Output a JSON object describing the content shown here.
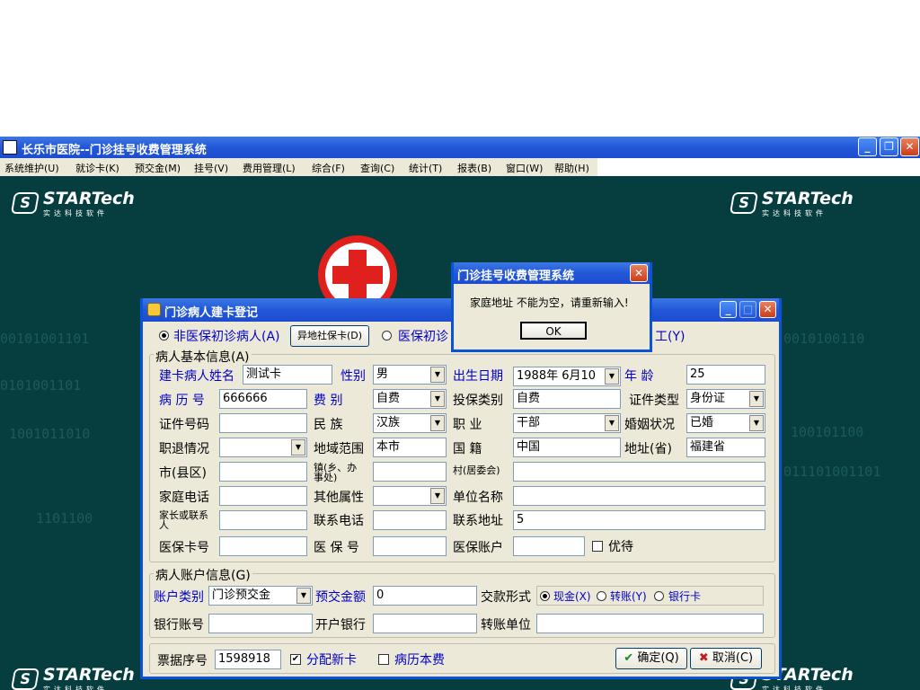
{
  "app": {
    "title": "长乐市医院--门诊挂号收费管理系统",
    "menu": [
      "系统维护(U)",
      "就诊卡(K)",
      "预交金(M)",
      "挂号(V)",
      "费用管理(L)",
      "综合(F)",
      "查询(C)",
      "统计(T)",
      "报表(B)",
      "窗口(W)",
      "帮助(H)"
    ]
  },
  "branding": {
    "name": "STARTech",
    "sub": "实达科技软件"
  },
  "background_binary": [
    "00101001101",
    "0101001101",
    "1001011010",
    "1101100",
    "0010100110",
    "100101100",
    "011101001101"
  ],
  "reg_dialog": {
    "title": "门诊病人建卡登记",
    "patient_types": {
      "non_insured": "非医保初诊病人(A)",
      "remote_card_button": "异地社保卡(D)",
      "insured": "医保初诊",
      "worker": "工(Y)"
    },
    "basic_group": "病人基本信息(A)",
    "fields": {
      "name_label": "建卡病人姓名",
      "name_value": "测试卡",
      "gender_label": "性别",
      "gender_value": "男",
      "birth_label": "出生日期",
      "birth_value": "1988年 6月10",
      "age_label": "年  龄",
      "age_value": "25",
      "record_label": "病 历 号",
      "record_value": "666666",
      "fee_label": "费  别",
      "fee_value": "自费",
      "insure_type_label": "投保类别",
      "insure_type_value": "自费",
      "id_type_label": "证件类型",
      "id_type_value": "身份证",
      "id_no_label": "证件号码",
      "id_no_value": "",
      "ethnic_label": "民  族",
      "ethnic_value": "汉族",
      "job_label": "职  业",
      "job_value": "干部",
      "marital_label": "婚姻状况",
      "marital_value": "已婚",
      "retire_label": "职退情况",
      "retire_value": "",
      "region_label": "地域范围",
      "region_value": "本市",
      "nation_label": "国  籍",
      "nation_value": "中国",
      "province_label": "地址(省)",
      "province_value": "福建省",
      "city_label": "市(县区)",
      "city_value": "",
      "town_label": "镇(乡、办事处)",
      "town_value": "",
      "village_label": "村(居委会)",
      "village_value": "",
      "home_phone_label": "家庭电话",
      "home_phone_value": "",
      "other_attr_label": "其他属性",
      "other_attr_value": "",
      "employer_label": "单位名称",
      "employer_value": "",
      "guardian_label": "家长或联系人",
      "guardian_value": "",
      "contact_phone_label": "联系电话",
      "contact_phone_value": "",
      "contact_addr_label": "联系地址",
      "contact_addr_value": "5",
      "insure_card_label": "医保卡号",
      "insure_card_value": "",
      "insure_no_label": "医 保 号",
      "insure_no_value": "",
      "insure_acct_label": "医保账户",
      "insure_acct_value": "",
      "priority_label": "优待"
    },
    "account_group": "病人账户信息(G)",
    "account": {
      "type_label": "账户类别",
      "type_value": "门诊预交金",
      "deposit_label": "预交金额",
      "deposit_value": "0",
      "pay_form_label": "交款形式",
      "pay_cash": "现金(X)",
      "pay_transfer": "转账(Y)",
      "pay_bank": "银行卡",
      "bank_acct_label": "银行账号",
      "bank_acct_value": "",
      "bank_label": "开户银行",
      "bank_value": "",
      "transfer_unit_label": "转账单位",
      "transfer_unit_value": ""
    },
    "footer": {
      "receipt_label": "票据序号",
      "receipt_value": "1598918",
      "new_card_label": "分配新卡",
      "record_fee_label": "病历本费",
      "ok_label": "确定(Q)",
      "cancel_label": "取消(C)"
    }
  },
  "msgbox": {
    "title": "门诊挂号收费管理系统",
    "message": "家庭地址  不能为空，请重新输入!",
    "ok_label": "OK"
  }
}
